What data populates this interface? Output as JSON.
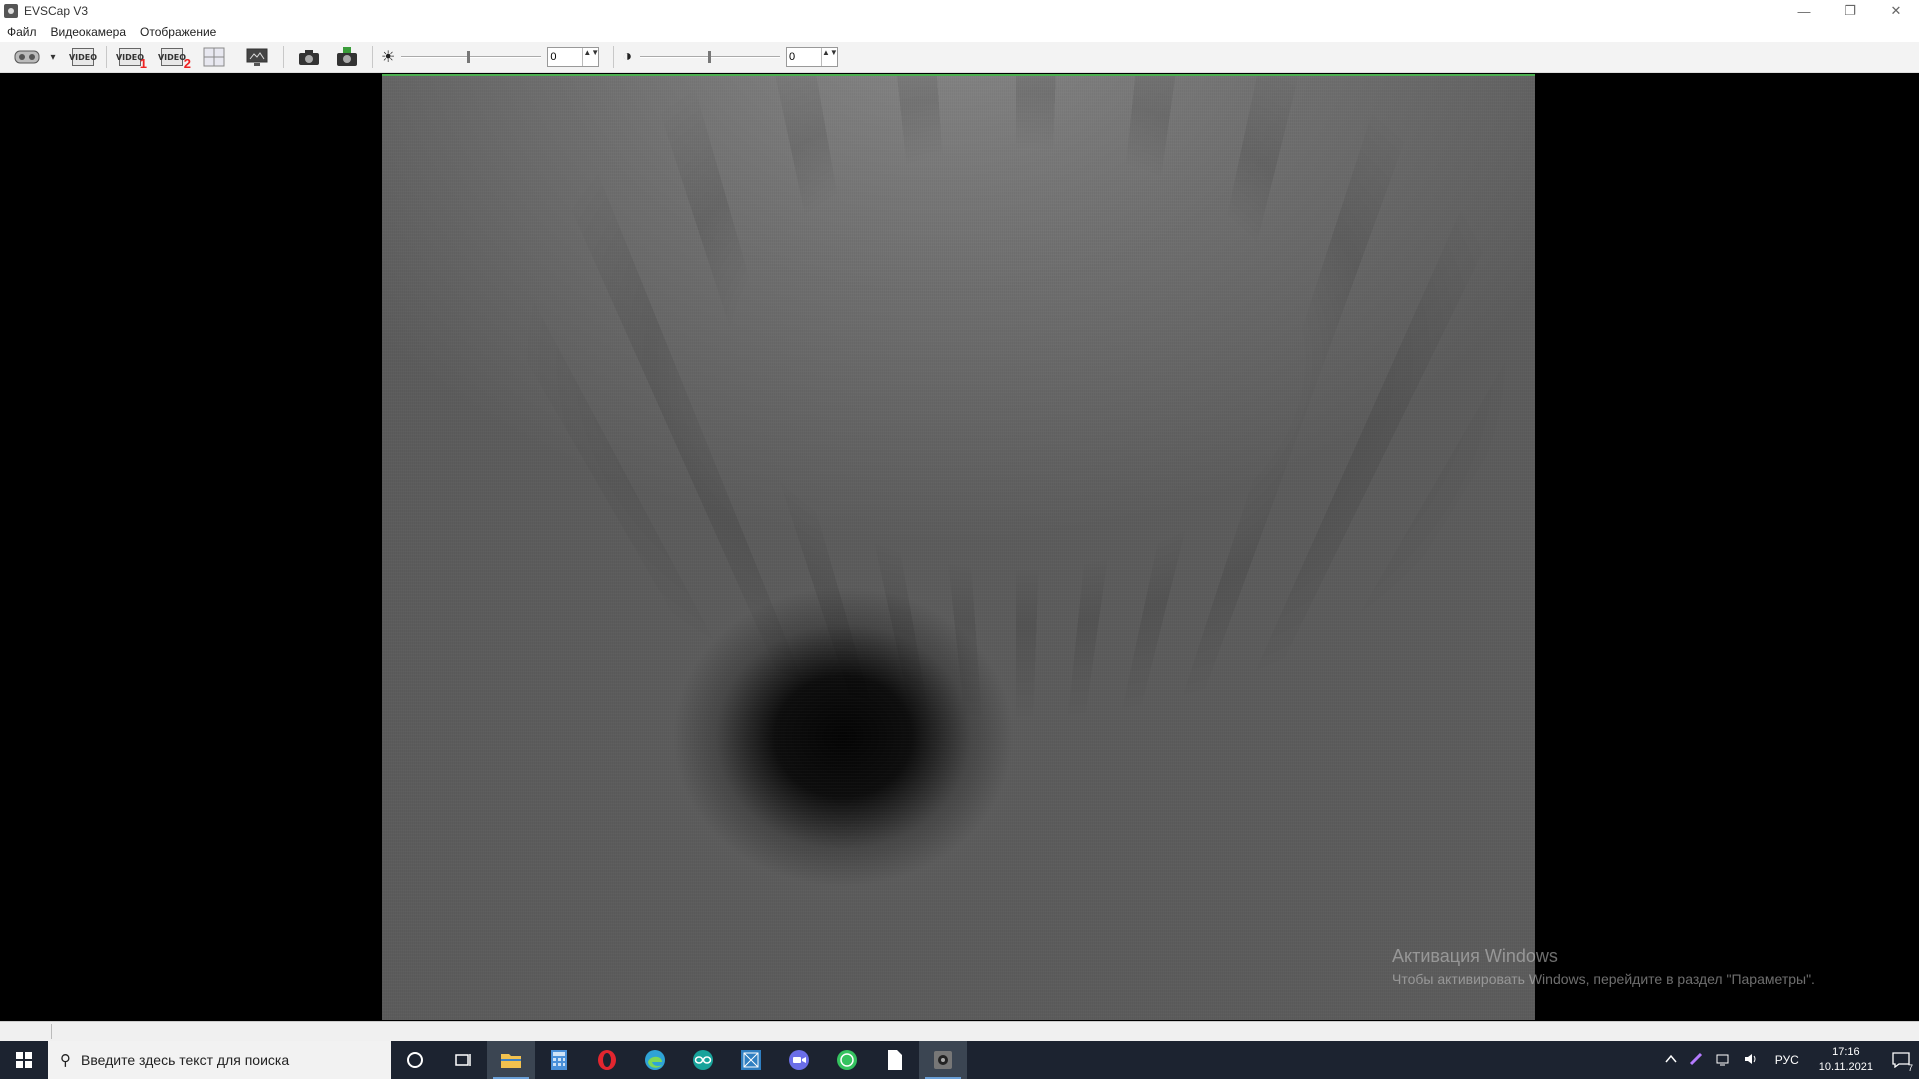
{
  "window": {
    "title": "EVSCap V3",
    "minimize": "—",
    "restore": "❐",
    "close": "✕"
  },
  "menu": {
    "items": [
      "Файл",
      "Видеокамера",
      "Отображение"
    ]
  },
  "toolbar": {
    "video_label": "VIDEO",
    "video1_sub": "1",
    "video2_sub": "2",
    "dropdown_glyph": "▾",
    "brightness_value": "0",
    "contrast_value": "0",
    "brightness_icon": "☀",
    "contrast_icon": "◑",
    "spin_glyph": "▲▼"
  },
  "watermark": {
    "title": "Активация Windows",
    "subtitle": "Чтобы активировать Windows, перейдите в раздел \"Параметры\"."
  },
  "taskbar": {
    "search_placeholder": "Введите здесь текст для поиска",
    "search_glyph": "⚲",
    "language": "РУС",
    "time": "17:16",
    "date": "10.11.2021",
    "notification_count": "7",
    "apps": [
      {
        "name": "cortana",
        "color": "#ffffff"
      },
      {
        "name": "task-view",
        "color": "#ffffff"
      },
      {
        "name": "file-explorer",
        "color": "#f2c14e"
      },
      {
        "name": "calculator",
        "color": "#4a90d9"
      },
      {
        "name": "opera",
        "color": "#e3262f"
      },
      {
        "name": "edge",
        "color": "#2fa3d6"
      },
      {
        "name": "arduino",
        "color": "#18a39b"
      },
      {
        "name": "app-blue",
        "color": "#2f7fc1"
      },
      {
        "name": "app-zoom",
        "color": "#6b6ee8"
      },
      {
        "name": "whatsapp",
        "color": "#35c35f"
      },
      {
        "name": "notepad",
        "color": "#ffffff"
      },
      {
        "name": "evscap",
        "color": "#777777"
      }
    ]
  }
}
